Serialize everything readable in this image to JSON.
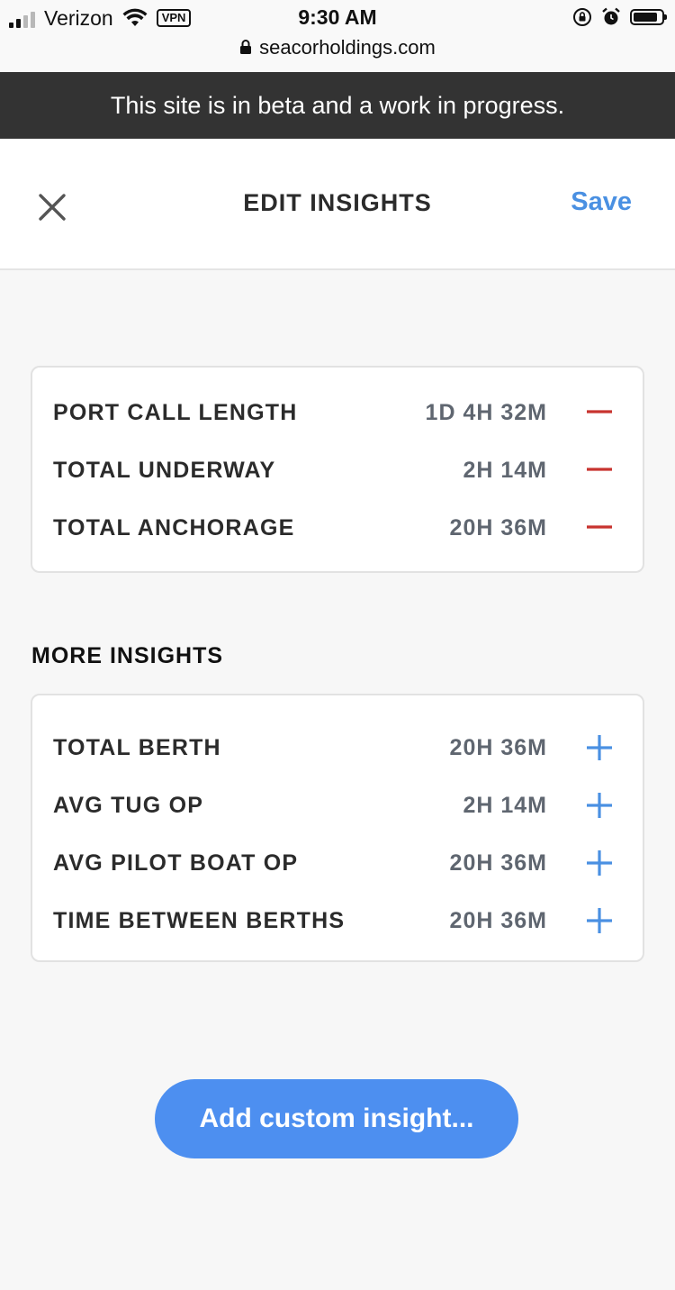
{
  "status_bar": {
    "carrier": "Verizon",
    "vpn": "VPN",
    "time": "9:30 AM",
    "url": "seacorholdings.com"
  },
  "banner": {
    "text": "This site is in beta and a work in progress."
  },
  "header": {
    "title": "EDIT INSIGHTS",
    "save_label": "Save"
  },
  "active_insights": [
    {
      "label": "PORT CALL LENGTH",
      "value": "1D 4H 32M",
      "action": "remove"
    },
    {
      "label": "TOTAL UNDERWAY",
      "value": "2H 14M",
      "action": "remove"
    },
    {
      "label": "TOTAL ANCHORAGE",
      "value": "20H 36M",
      "action": "remove"
    }
  ],
  "more_insights": {
    "title": "MORE INSIGHTS",
    "items": [
      {
        "label": "TOTAL BERTH",
        "value": "20H 36M",
        "action": "add"
      },
      {
        "label": "AVG TUG OP",
        "value": "2H 14M",
        "action": "add"
      },
      {
        "label": "AVG PILOT BOAT OP",
        "value": "20H 36M",
        "action": "add"
      },
      {
        "label": "TIME BETWEEN BERTHS",
        "value": "20H 36M",
        "action": "add"
      }
    ]
  },
  "add_custom_label": "Add custom insight...",
  "colors": {
    "remove": "#c8332f",
    "add": "#4a90e2",
    "accent": "#4d8ff0",
    "banner": "#333333"
  }
}
